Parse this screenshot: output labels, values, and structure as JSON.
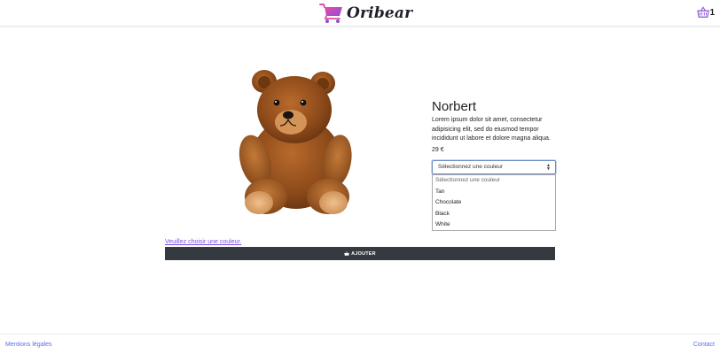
{
  "header": {
    "brand_name": "Oribear",
    "cart_count": "1",
    "colors": {
      "cart_purple": "#9b59d0",
      "cart_pink": "#e94aa6"
    }
  },
  "product": {
    "image_icon": "teddy-bear",
    "name": "Norbert",
    "description": "Lorem ipsum dolor sit amet, consectetur adipisicing elit, sed do eiusmod tempor incididunt ut labore et dolore magna aliqua.",
    "price": "29 €",
    "color_select": {
      "selected": "Sélectionnez une couleur",
      "options": [
        "Sélectionnez une couleur",
        "Tan",
        "Chocolate",
        "Black",
        "White"
      ]
    },
    "warning": "Veuillez choisir une couleur.",
    "add_button_label": "AJOUTER"
  },
  "footer": {
    "legal_link": "Mentions légales",
    "contact_link": "Contact"
  },
  "colors": {
    "accent_link": "#5a6cf0",
    "warning": "#7b4de6",
    "button_bg": "#343a40"
  }
}
